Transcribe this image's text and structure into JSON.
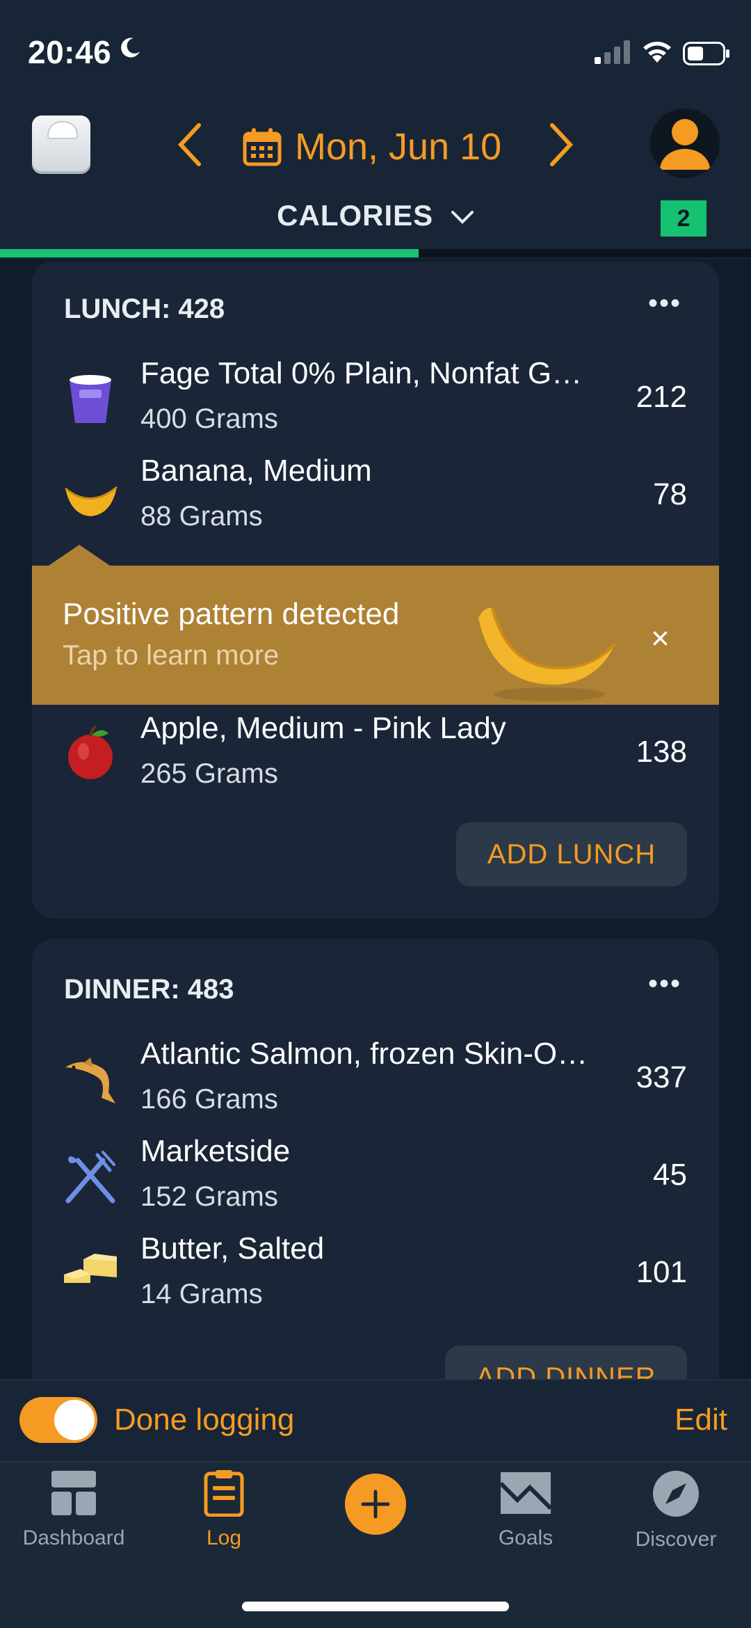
{
  "status_bar": {
    "time": "20:46"
  },
  "header": {
    "date": "Mon, Jun 10",
    "nutrient_selector": "CALORIES",
    "badge_count": "2",
    "progress_fraction": 0.557
  },
  "lunch": {
    "title": "LUNCH: 428",
    "items": [
      {
        "name": "Fage Total 0% Plain, Nonfat G…",
        "qty": "400 Grams",
        "cal": "212"
      },
      {
        "name": "Banana, Medium",
        "qty": "88 Grams",
        "cal": "78"
      },
      {
        "name": "Apple, Medium - Pink Lady",
        "qty": "265 Grams",
        "cal": "138"
      }
    ],
    "add_label": "ADD LUNCH"
  },
  "tip": {
    "title": "Positive pattern detected",
    "subtitle": "Tap to learn more",
    "close": "×"
  },
  "dinner": {
    "title": "DINNER: 483",
    "items": [
      {
        "name": "Atlantic Salmon, frozen Skin-O…",
        "qty": "166 Grams",
        "cal": "337"
      },
      {
        "name": "Marketside",
        "qty": "152 Grams",
        "cal": "45"
      },
      {
        "name": "Butter, Salted",
        "qty": "14 Grams",
        "cal": "101"
      }
    ],
    "add_label": "ADD DINNER"
  },
  "done_bar": {
    "done_label": "Done logging",
    "edit_label": "Edit",
    "toggle_on": true
  },
  "tabs": {
    "dashboard": "Dashboard",
    "log": "Log",
    "goals": "Goals",
    "discover": "Discover"
  },
  "colors": {
    "accent": "#f59b23",
    "success": "#18c374",
    "background": "#111c2b",
    "card": "#1a2637",
    "tip": "#ae8235"
  }
}
